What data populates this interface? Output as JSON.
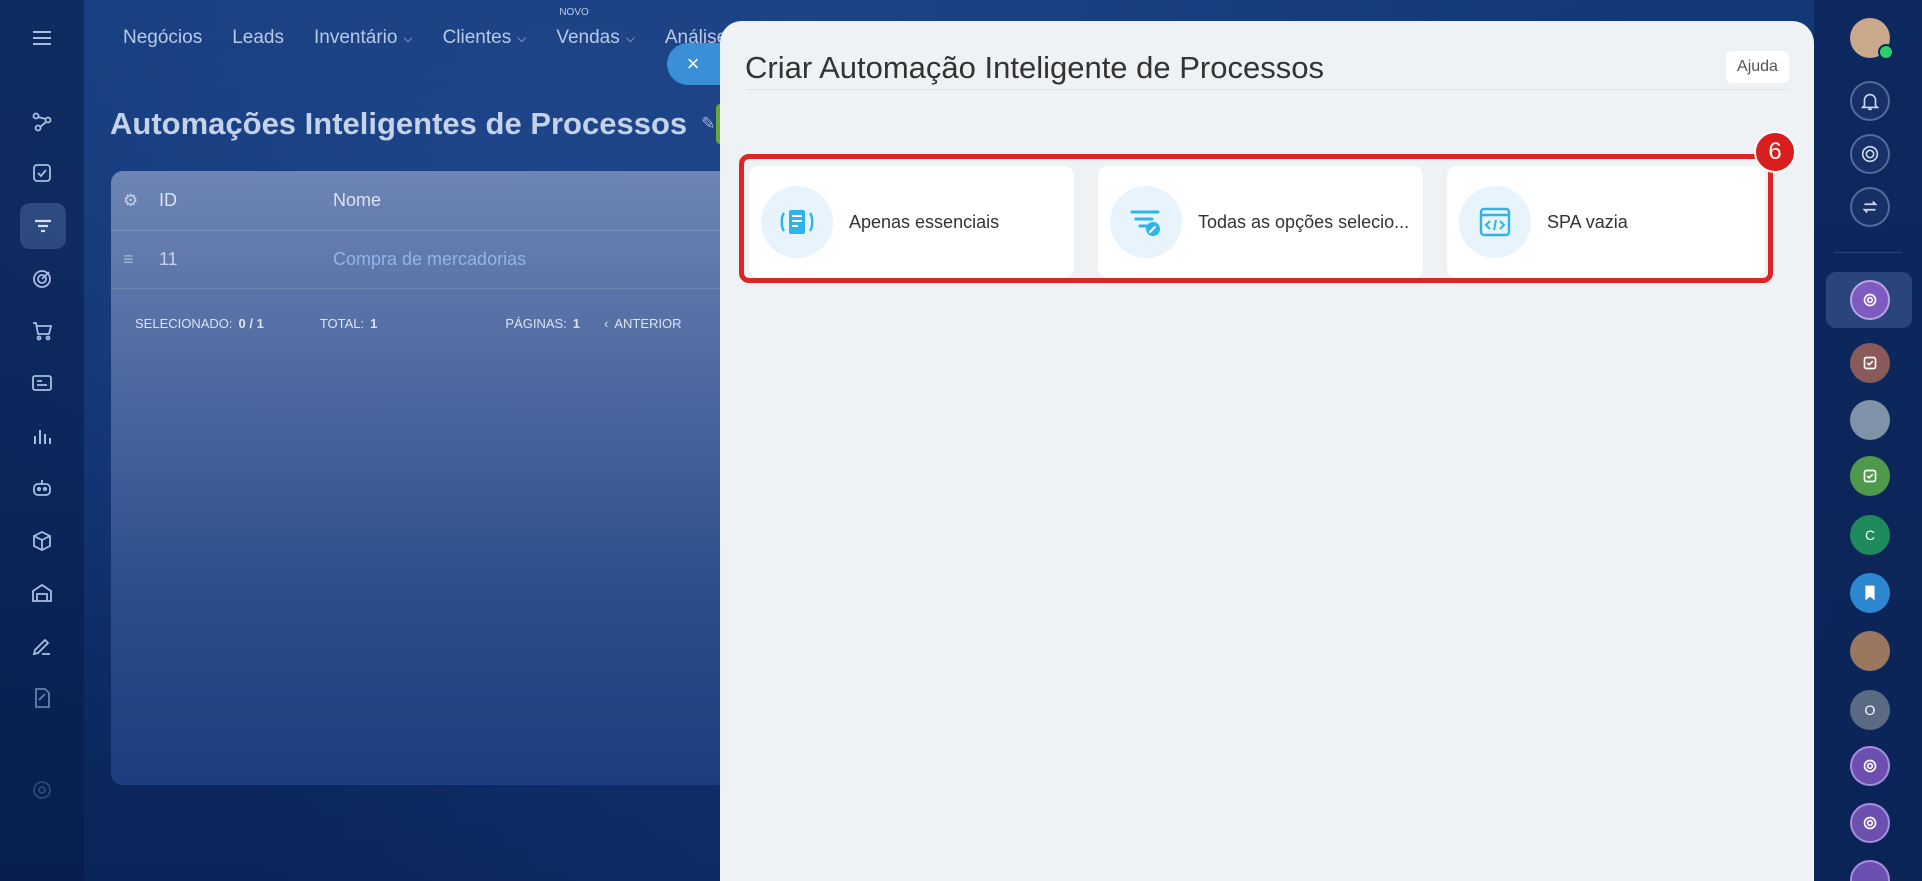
{
  "top_menu": {
    "items": [
      {
        "label": "Negócios",
        "has_chevron": false
      },
      {
        "label": "Leads",
        "has_chevron": false
      },
      {
        "label": "Inventário",
        "has_chevron": true
      },
      {
        "label": "Clientes",
        "has_chevron": true
      },
      {
        "label": "Vendas",
        "has_chevron": true,
        "badge": "NOVO"
      },
      {
        "label": "Análise",
        "has_chevron": false
      }
    ]
  },
  "background_page": {
    "title": "Automações Inteligentes de Processos",
    "grid": {
      "columns": [
        "ID",
        "Nome"
      ],
      "rows": [
        {
          "id": "11",
          "name": "Compra de mercadorias"
        }
      ],
      "footer": {
        "selected_label": "SELECIONADO:",
        "selected_value": "0 / 1",
        "total_label": "TOTAL:",
        "total_value": "1",
        "pages_label": "PÁGINAS:",
        "pages_value": "1",
        "prev_label": "ANTERIOR"
      }
    }
  },
  "modal": {
    "title": "Criar Automação Inteligente de Processos",
    "help_label": "Ajuda",
    "options": [
      {
        "label": "Apenas essenciais",
        "icon": "document-list-icon"
      },
      {
        "label": "Todas as opções selecio...",
        "icon": "filter-edit-icon"
      },
      {
        "label": "SPA vazia",
        "icon": "code-window-icon"
      }
    ],
    "annotation_number": "6"
  },
  "right_rail": {
    "avatar_letters": [
      "C",
      "O"
    ]
  },
  "colors": {
    "accent_blue": "#3b8fd6",
    "highlight_red": "#e02424",
    "icon_cyan": "#2fb3e8",
    "modal_bg": "#eef2f5"
  }
}
